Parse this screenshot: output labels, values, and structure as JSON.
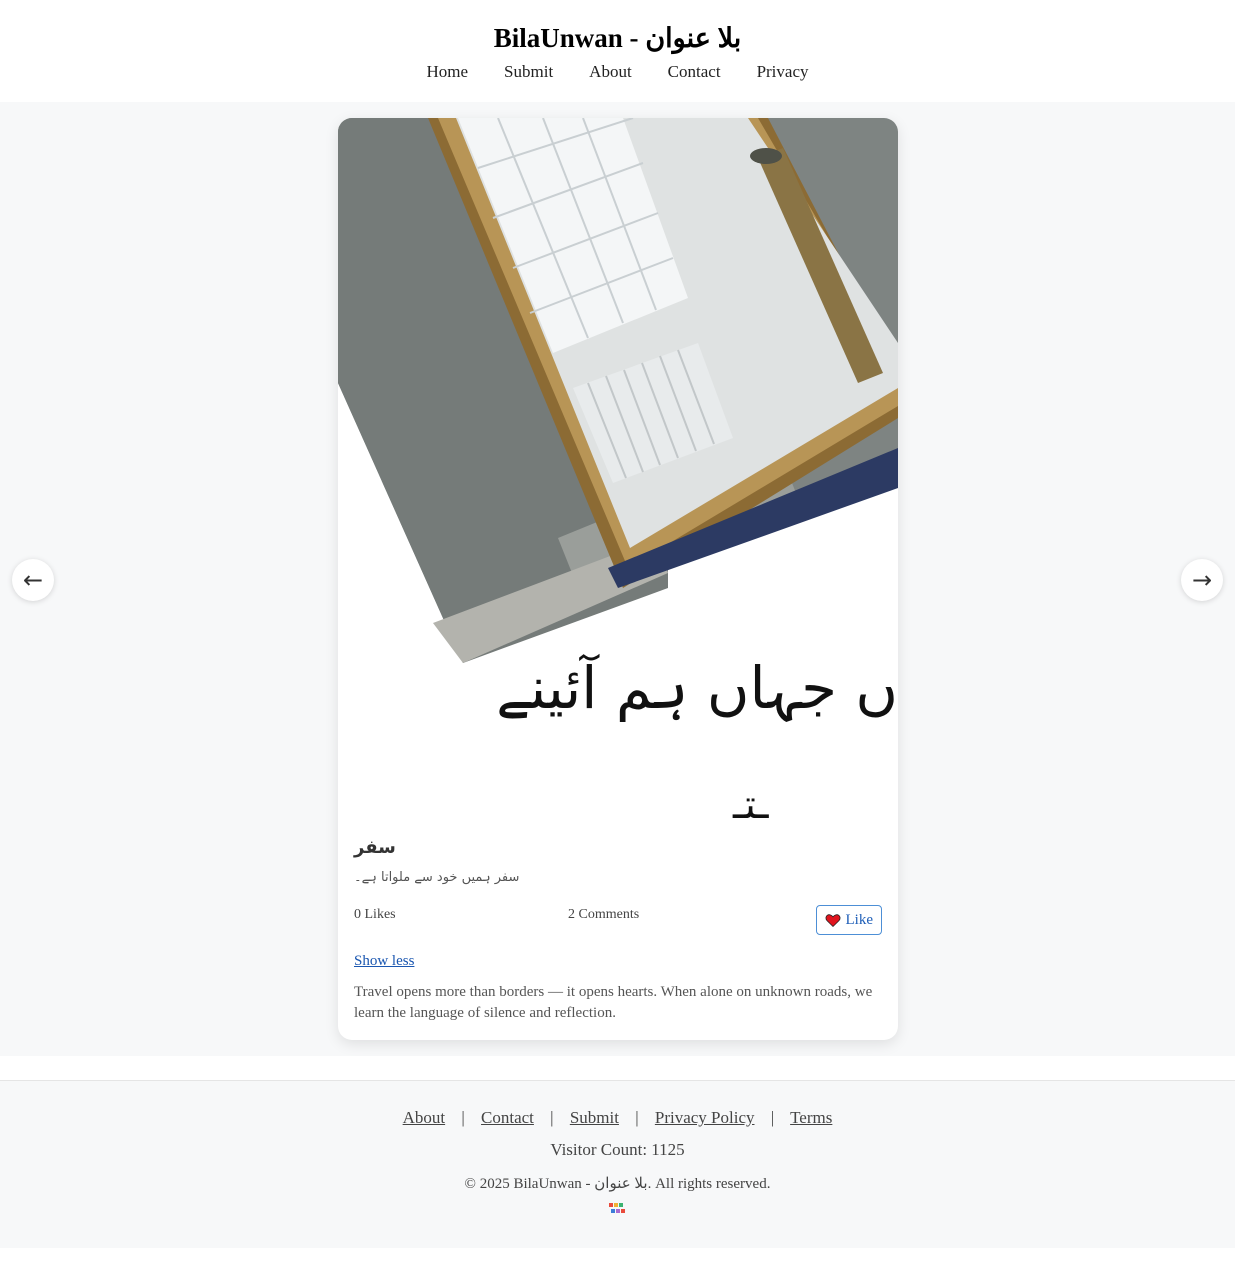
{
  "header": {
    "title": "BilaUnwan - بلا عنوان",
    "nav": [
      "Home",
      "Submit",
      "About",
      "Contact",
      "Privacy"
    ]
  },
  "post": {
    "image_text": "ں جہاں ہم آئینے",
    "title": "سفر",
    "excerpt": "سفر ہمیں خود سے ملواتا ہے۔",
    "likes": "0 Likes",
    "comments": "2 Comments",
    "like_label": "Like",
    "show_less": "Show less",
    "body": "Travel opens more than borders — it opens hearts. When alone on unknown roads, we learn the language of silence and reflection."
  },
  "carousel": {
    "prev_icon": "←",
    "next_icon": "→"
  },
  "footer": {
    "links": [
      "About",
      "Contact",
      "Submit",
      "Privacy Policy",
      "Terms"
    ],
    "separator": "|",
    "visitor": "Visitor Count: 1125",
    "copyright": "© 2025 BilaUnwan - بلا عنوان. All rights reserved."
  },
  "colors": {
    "accent": "#1a56b0",
    "heart": "#e0141e",
    "page_bg": "#f7f8f9"
  }
}
